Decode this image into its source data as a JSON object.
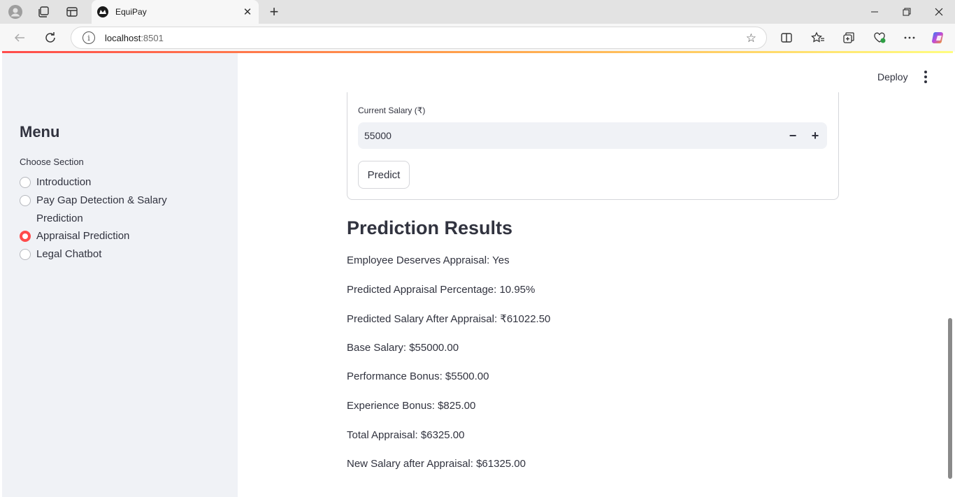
{
  "browser": {
    "tab_title": "EquiPay",
    "address_host": "localhost",
    "address_port": ":8501"
  },
  "sidebar": {
    "menu_title": "Menu",
    "choose_label": "Choose Section",
    "items": [
      {
        "label": "Introduction",
        "selected": false
      },
      {
        "label": "Pay Gap Detection & Salary Prediction",
        "selected": false
      },
      {
        "label": "Appraisal Prediction",
        "selected": true
      },
      {
        "label": "Legal Chatbot",
        "selected": false
      }
    ]
  },
  "header": {
    "deploy_label": "Deploy"
  },
  "form": {
    "salary_label": "Current Salary (₹)",
    "salary_value": "55000",
    "decrement_label": "−",
    "increment_label": "+",
    "predict_label": "Predict"
  },
  "results": {
    "title": "Prediction Results",
    "lines": [
      "Employee Deserves Appraisal: Yes",
      "Predicted Appraisal Percentage: 10.95%",
      "Predicted Salary After Appraisal: ₹61022.50",
      "Base Salary: $55000.00",
      "Performance Bonus: $5500.00",
      "Experience Bonus: $825.00",
      "Total Appraisal: $6325.00",
      "New Salary after Appraisal: $61325.00"
    ]
  },
  "colors": {
    "accent": "#ff4b4b",
    "sidebar_bg": "#f0f2f6",
    "text": "#31333f"
  }
}
